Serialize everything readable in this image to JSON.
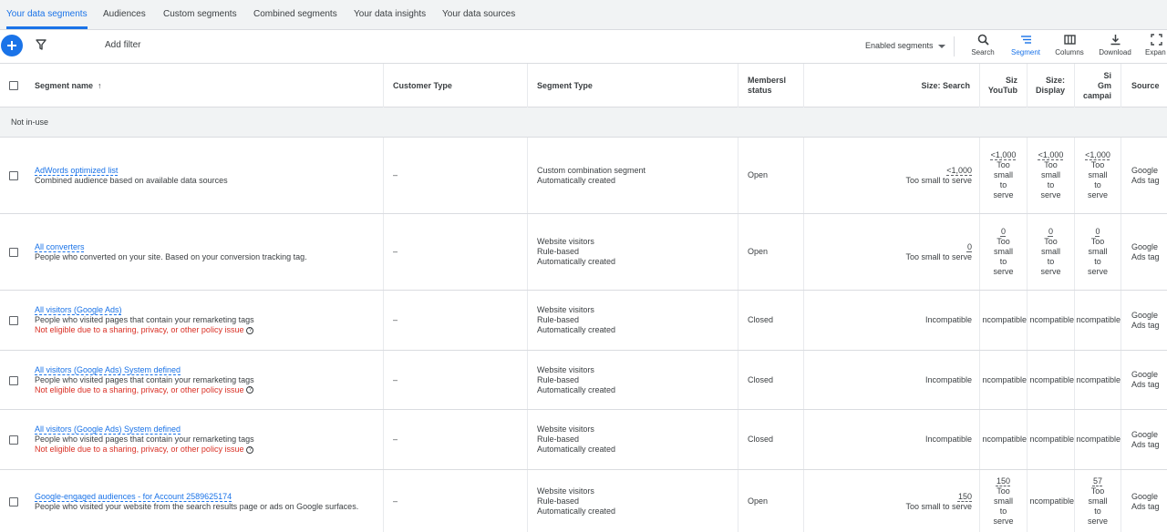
{
  "tabs": [
    "Your data segments",
    "Audiences",
    "Custom segments",
    "Combined segments",
    "Your data insights",
    "Your data sources"
  ],
  "toolbar": {
    "add_filter": "Add filter",
    "enabled_segments": "Enabled segments",
    "tools": [
      "Search",
      "Segment",
      "Columns",
      "Download",
      "Expan"
    ]
  },
  "columns": {
    "name": "Segment name",
    "sort_arrow": "↑",
    "customer_type": "Customer Type",
    "segment_type": "Segment Type",
    "membership_l1": "Membersl",
    "membership_l2": "status",
    "size_search": "Size: Search",
    "size_youtube_l1": "Siz",
    "size_youtube_l2": "YouTub",
    "size_display_l1": "Size:",
    "size_display_l2": "Display",
    "size_gmail_l1": "Si",
    "size_gmail_l2": "Gm",
    "size_gmail_l3": "campai",
    "source": "Source"
  },
  "section_label": "Not in-use",
  "rows": [
    {
      "name": "AdWords optimized list",
      "desc": "Combined audience based on available data sources",
      "warning": "",
      "customer_type": "–",
      "seg_type": [
        "Custom combination segment",
        "Automatically created"
      ],
      "membership": "Open",
      "search": [
        "<1,000",
        "Too small to serve"
      ],
      "youtube": [
        "<1,000",
        "Too",
        "small",
        "to",
        "serve"
      ],
      "display": [
        "<1,000",
        "Too",
        "small",
        "to",
        "serve"
      ],
      "gmail": [
        "<1,000",
        "Too",
        "small",
        "to",
        "serve"
      ],
      "source": [
        "Google",
        "Ads tag"
      ]
    },
    {
      "name": "All converters",
      "desc": "People who converted on your site. Based on your conversion tracking tag.",
      "warning": "",
      "customer_type": "–",
      "seg_type": [
        "Website visitors",
        "Rule-based",
        "Automatically created"
      ],
      "membership": "Open",
      "search": [
        "0",
        "Too small to serve"
      ],
      "youtube": [
        "0",
        "Too",
        "small",
        "to",
        "serve"
      ],
      "display": [
        "0",
        "Too",
        "small",
        "to",
        "serve"
      ],
      "gmail": [
        "0",
        "Too",
        "small",
        "to",
        "serve"
      ],
      "source": [
        "Google",
        "Ads tag"
      ]
    },
    {
      "name": "All visitors (Google Ads)",
      "desc": "People who visited pages that contain your remarketing tags",
      "warning": "Not eligible due to a sharing, privacy, or other policy issue",
      "customer_type": "–",
      "seg_type": [
        "Website visitors",
        "Rule-based",
        "Automatically created"
      ],
      "membership": "Closed",
      "search": [
        "Incompatible"
      ],
      "youtube": [
        "ncompatible"
      ],
      "display": [
        "ncompatible"
      ],
      "gmail": [
        "ncompatible"
      ],
      "source": [
        "Google",
        "Ads tag"
      ]
    },
    {
      "name": "All visitors (Google Ads) System defined",
      "desc": "People who visited pages that contain your remarketing tags",
      "warning": "Not eligible due to a sharing, privacy, or other policy issue",
      "customer_type": "–",
      "seg_type": [
        "Website visitors",
        "Rule-based",
        "Automatically created"
      ],
      "membership": "Closed",
      "search": [
        "Incompatible"
      ],
      "youtube": [
        "ncompatible"
      ],
      "display": [
        "ncompatible"
      ],
      "gmail": [
        "ncompatible"
      ],
      "source": [
        "Google",
        "Ads tag"
      ]
    },
    {
      "name": "All visitors (Google Ads) System defined",
      "desc": "People who visited pages that contain your remarketing tags",
      "warning": "Not eligible due to a sharing, privacy, or other policy issue",
      "customer_type": "–",
      "seg_type": [
        "Website visitors",
        "Rule-based",
        "Automatically created"
      ],
      "membership": "Closed",
      "search": [
        "Incompatible"
      ],
      "youtube": [
        "ncompatible"
      ],
      "display": [
        "ncompatible"
      ],
      "gmail": [
        "ncompatible"
      ],
      "source": [
        "Google",
        "Ads tag"
      ]
    },
    {
      "name": "Google-engaged audiences - for Account 2589625174",
      "desc": "People who visited your website from the search results page or ads on Google surfaces.",
      "warning": "",
      "customer_type": "–",
      "seg_type": [
        "Website visitors",
        "Rule-based",
        "Automatically created"
      ],
      "membership": "Open",
      "search": [
        "150",
        "Too small to serve"
      ],
      "youtube": [
        "150",
        "Too",
        "small",
        "to",
        "serve"
      ],
      "display": [
        "ncompatible"
      ],
      "gmail": [
        "57",
        "Too",
        "small",
        "to",
        "serve"
      ],
      "source": [
        "Google",
        "Ads tag"
      ]
    }
  ],
  "colors": {
    "accent": "#1a73e8",
    "warning": "#d93025",
    "tab_bg": "#f1f3f4"
  },
  "icons": [
    "add-icon",
    "filter-icon",
    "search-icon",
    "segment-icon",
    "columns-icon",
    "download-icon",
    "expand-icon",
    "sort-arrow-icon",
    "help-icon"
  ]
}
